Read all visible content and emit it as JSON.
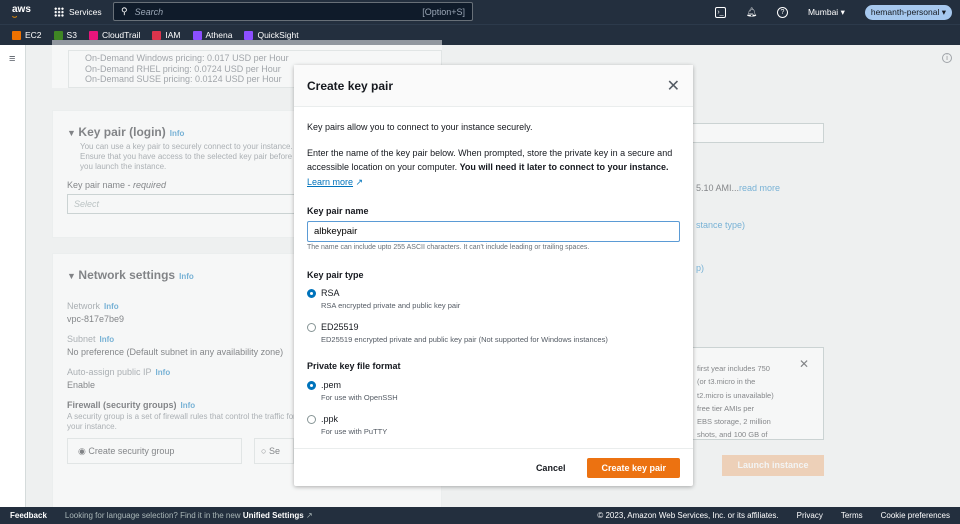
{
  "nav": {
    "logo": "aws",
    "services": "Services",
    "search_placeholder": "Search",
    "search_shortcut": "[Option+S]",
    "region": "Mumbai",
    "account": "hemanth-personal"
  },
  "favorites": [
    {
      "label": "EC2",
      "color": "#ed7100"
    },
    {
      "label": "S3",
      "color": "#3f8624"
    },
    {
      "label": "CloudTrail",
      "color": "#e7157b"
    },
    {
      "label": "IAM",
      "color": "#dd344c"
    },
    {
      "label": "Athena",
      "color": "#8c4fff"
    },
    {
      "label": "QuickSight",
      "color": "#8c4fff"
    }
  ],
  "background": {
    "pricing": [
      "On-Demand Windows pricing: 0.017 USD per Hour",
      "On-Demand RHEL pricing: 0.0724 USD per Hour",
      "On-Demand SUSE pricing: 0.0124 USD per Hour"
    ],
    "keypair_title": "Key pair (login)",
    "info": "Info",
    "keypair_desc": "You can use a key pair to securely connect to your instance. Ensure that you have access to the selected key pair before you launch the instance.",
    "keypair_name_label": "Key pair name - ",
    "required": "required",
    "select": "Select",
    "network_title": "Network settings",
    "network_label": "Network",
    "network_value": "vpc-817e7be9",
    "subnet_label": "Subnet",
    "subnet_value": "No preference (Default subnet in any availability zone)",
    "public_ip_label": "Auto-assign public IP",
    "public_ip_value": "Enable",
    "firewall_label": "Firewall (security groups)",
    "firewall_desc": "A security group is a set of firewall rules that control the traffic for your instance.",
    "create_sg": "Create security group",
    "select_sg": "Se",
    "right_ami": "5.10 AMI...",
    "read_more": "read more",
    "right_type": "stance type)",
    "right_p": "p)",
    "free_tier": [
      "first year includes 750",
      "(or t3.micro in the",
      "t2.micro is unavailable)",
      "free tier AMIs per",
      "EBS storage, 2 million",
      "shots, and 100 GB of"
    ],
    "launch": "Launch instance"
  },
  "modal": {
    "title": "Create key pair",
    "intro": "Key pairs allow you to connect to your instance securely.",
    "desc": "Enter the name of the key pair below. When prompted, store the private key in a secure and accessible location on your computer. ",
    "desc_bold": "You will need it later to connect to your instance.",
    "learn_more": "Learn more",
    "name_label": "Key pair name",
    "name_value": "albkeypair",
    "name_hint": "The name can include upto 255 ASCII characters. It can't include leading or trailing spaces.",
    "type_label": "Key pair type",
    "types": [
      {
        "label": "RSA",
        "desc": "RSA encrypted private and public key pair",
        "selected": true
      },
      {
        "label": "ED25519",
        "desc": "ED25519 encrypted private and public key pair (Not supported for Windows instances)",
        "selected": false
      }
    ],
    "format_label": "Private key file format",
    "formats": [
      {
        "label": ".pem",
        "desc": "For use with OpenSSH",
        "selected": true
      },
      {
        "label": ".ppk",
        "desc": "For use with PuTTY",
        "selected": false
      }
    ],
    "cancel": "Cancel",
    "create": "Create key pair"
  },
  "footer": {
    "feedback": "Feedback",
    "lang_msg": "Looking for language selection? Find it in the new ",
    "unified": "Unified Settings",
    "copyright": "© 2023, Amazon Web Services, Inc. or its affiliates.",
    "privacy": "Privacy",
    "terms": "Terms",
    "cookies": "Cookie preferences"
  }
}
